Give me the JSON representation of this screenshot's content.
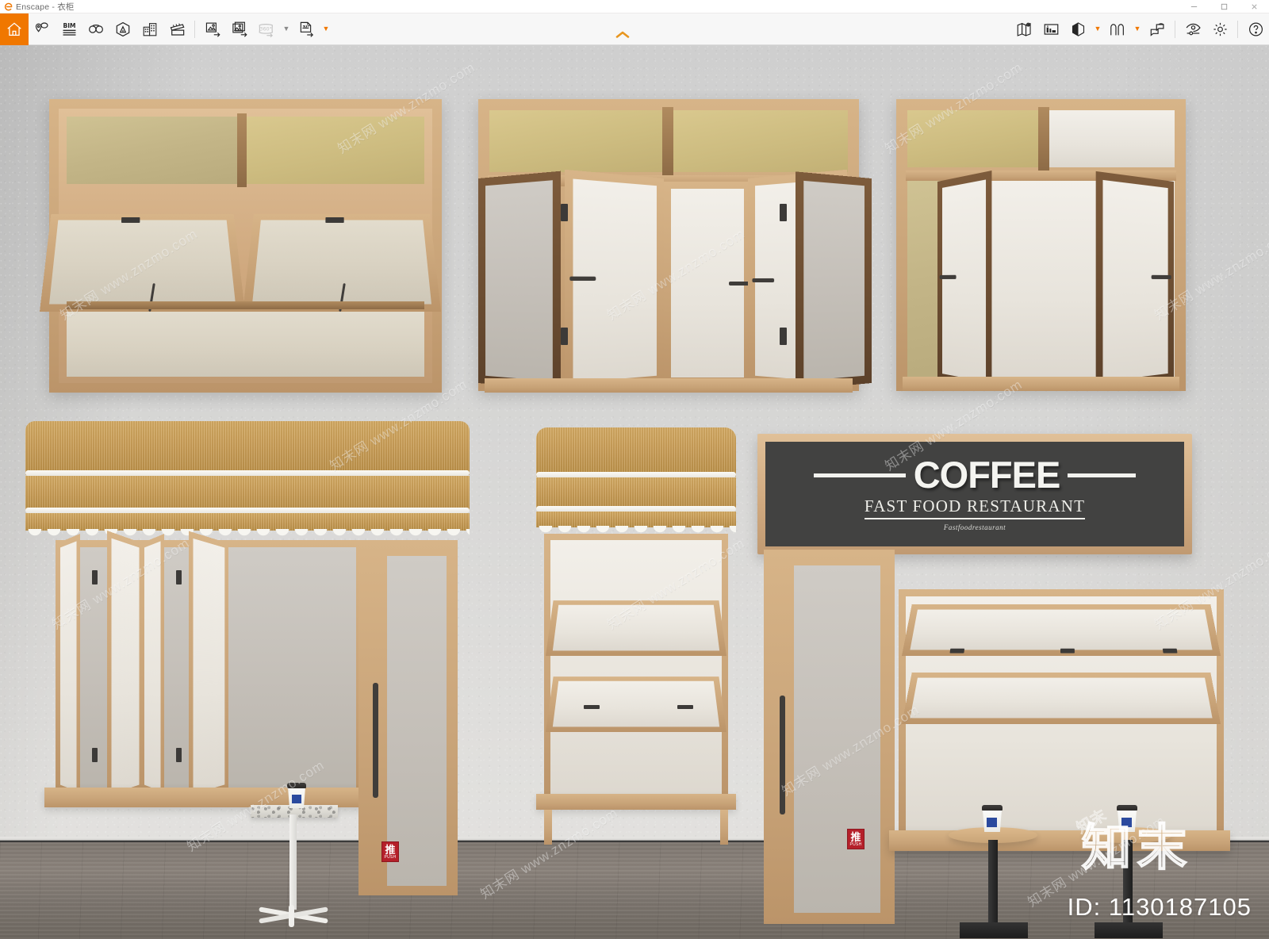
{
  "window": {
    "app_name": "Enscape",
    "document_name": "衣柜",
    "title": "Enscape - 衣柜",
    "controls": {
      "minimize": "minimize-button",
      "maximize": "maximize-button",
      "close": "close-button"
    }
  },
  "toolbar": {
    "left_items": [
      {
        "name": "home-icon",
        "label": "Home",
        "state": "active"
      },
      {
        "name": "asset-library-icon",
        "label": "Asset Library",
        "state": "normal"
      },
      {
        "name": "bim-icon",
        "label": "BIM Info",
        "state": "normal"
      },
      {
        "name": "vr-headset-icon",
        "label": "Start VR",
        "state": "normal"
      },
      {
        "name": "site-context-icon",
        "label": "Site Context",
        "state": "normal"
      },
      {
        "name": "building-icon",
        "label": "Project Buildings",
        "state": "normal"
      },
      {
        "name": "video-clapperboard-icon",
        "label": "Video Editor",
        "state": "normal"
      }
    ],
    "export_items": [
      {
        "name": "export-image-icon",
        "label": "Render Image",
        "state": "normal"
      },
      {
        "name": "export-batch-image-icon",
        "label": "Batch Rendering",
        "state": "normal"
      },
      {
        "name": "export-panorama-360-icon",
        "label": "360 Panorama",
        "state": "disabled"
      },
      {
        "name": "panorama-dropdown-caret",
        "label": "Panorama options",
        "state": "disabled"
      },
      {
        "name": "export-exe-icon",
        "label": "Standalone EXE Export",
        "state": "normal"
      },
      {
        "name": "exe-dropdown-caret",
        "label": "Export options",
        "state": "normal"
      }
    ],
    "right_items": [
      {
        "name": "map-pin-icon",
        "label": "Location Settings",
        "state": "normal"
      },
      {
        "name": "materials-icon",
        "label": "Material Editor",
        "state": "normal"
      },
      {
        "name": "white-mode-icon",
        "label": "White Mode",
        "state": "normal"
      },
      {
        "name": "white-mode-dropdown-caret",
        "label": "White Mode options",
        "state": "normal"
      },
      {
        "name": "view-management-icon",
        "label": "View Management",
        "state": "normal"
      },
      {
        "name": "view-dropdown-caret",
        "label": "View options",
        "state": "normal"
      },
      {
        "name": "synchronize-view-icon",
        "label": "Synchronize Views",
        "state": "normal"
      },
      {
        "name": "visual-settings-icon",
        "label": "Visual Settings",
        "state": "normal"
      },
      {
        "name": "general-settings-icon",
        "label": "General Settings",
        "state": "normal"
      },
      {
        "name": "help-icon",
        "label": "Help",
        "state": "normal"
      }
    ],
    "collapse_toggle": "collapse-toolbar-chevron",
    "accent_color": "#f07700"
  },
  "scene": {
    "description": "3D rendered showroom wall with wooden window and door systems",
    "wall_color": "#d6d5d2",
    "floor_color": "#7f7871",
    "top_row": [
      {
        "name": "awning-window-double",
        "type": "Awning / hopper window",
        "sashes": 2
      },
      {
        "name": "bifold-window-four-panel",
        "type": "Bi-fold window",
        "sashes": 4
      },
      {
        "name": "casement-window-double",
        "type": "Casement window",
        "sashes": 2
      }
    ],
    "bottom_row": [
      {
        "name": "storefront-bifold-with-awning",
        "type": "Folding servery window with fabric awning + entry door"
      },
      {
        "name": "narrow-awning-window-unit",
        "type": "Narrow tilt-out servery window with awning"
      },
      {
        "name": "coffee-shop-facade",
        "type": "Coffee shop facade with signage, door and bar counter"
      }
    ]
  },
  "signage": {
    "coffee_title": "COFFEE",
    "subtitle": "FAST FOOD RESTAURANT",
    "script": "Fastfoodrestaurant",
    "board_color": "#424241",
    "text_color": "#f4f4f0",
    "frame_color": "#d0a972"
  },
  "door_stickers": [
    {
      "cn": "推",
      "en": "PUSH",
      "color": "#b5202a"
    },
    {
      "cn": "推",
      "en": "PUSH",
      "color": "#b5202a"
    }
  ],
  "props": {
    "coffee_cups": 3,
    "cup_lid_color": "#332f2c",
    "cup_label_color": "#2b4a9e",
    "round_tables": 2,
    "terrazzo_table": 1
  },
  "watermark": {
    "site_text": "知末网 www.znzmo.com",
    "logo_text": "知末",
    "id_label": "ID: 1130187105"
  }
}
